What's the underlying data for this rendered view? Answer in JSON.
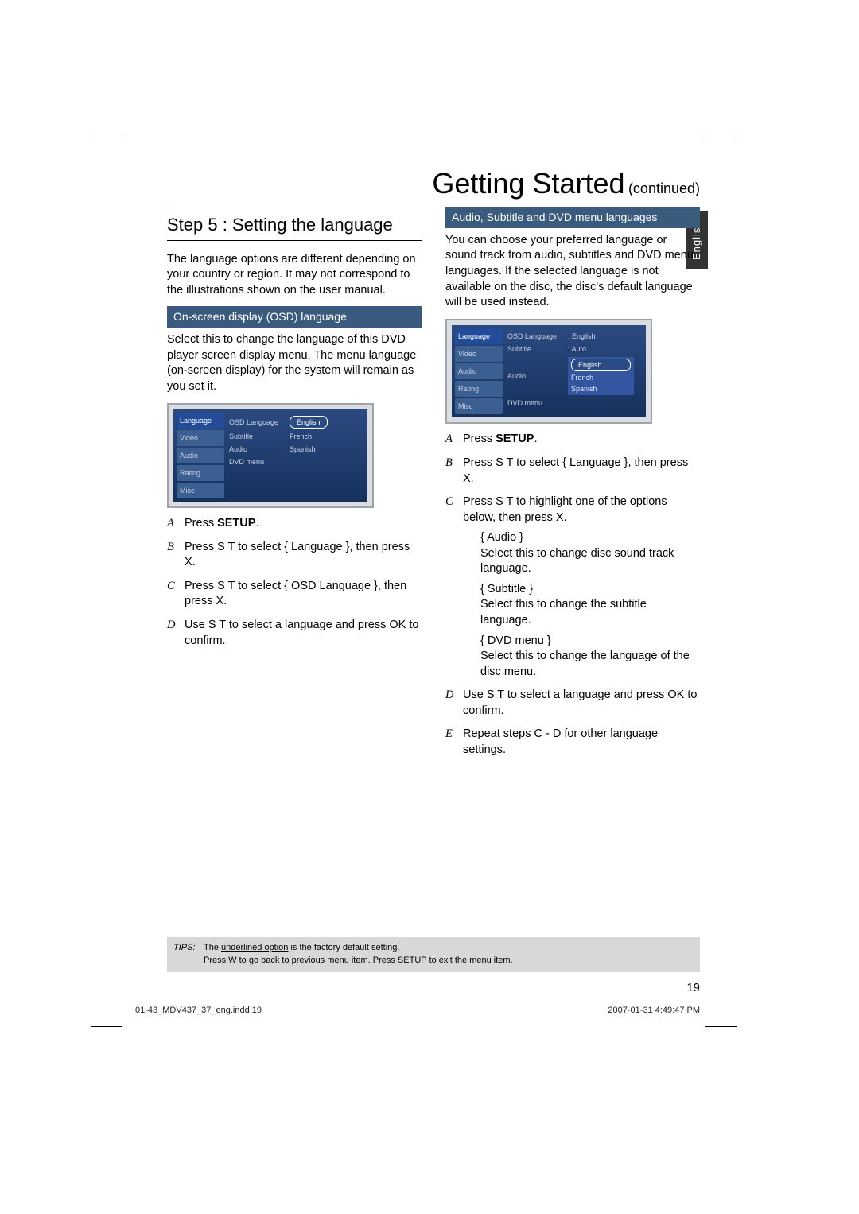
{
  "title": {
    "main": "Getting Started",
    "suffix": "(continued)"
  },
  "lang_tab": "English",
  "left": {
    "step_heading": "Step 5 : Setting the language",
    "intro": "The language options are different depending on your country or region. It may not correspond to the illustrations shown on the user manual.",
    "sub_heading": "On-screen display (OSD) language",
    "sub_body": "Select this to change the language of this DVD player screen display menu. The menu language (on-screen display) for the system will remain as you set it.",
    "menu": {
      "side": [
        "Language",
        "Video",
        "Audio",
        "Rating",
        "Misc"
      ],
      "rows": [
        {
          "lbl": "OSD Language",
          "val": "English",
          "pill": true
        },
        {
          "lbl": "Subtitle",
          "val": "French"
        },
        {
          "lbl": "Audio",
          "val": "Spanish"
        },
        {
          "lbl": "DVD menu",
          "val": ""
        }
      ]
    },
    "steps": [
      {
        "m": "A",
        "pre": "Press ",
        "kw": "SETUP",
        "post": "."
      },
      {
        "m": "B",
        "text": "Press  S  T to select { Language }, then press  X."
      },
      {
        "m": "C",
        "text": "Press  S  T to select { OSD Language }, then press  X."
      },
      {
        "m": "D",
        "text": "Use  S  T to select a language and press OK to confirm."
      }
    ]
  },
  "right": {
    "sub_heading": "Audio, Subtitle and DVD menu languages",
    "intro": "You can choose your preferred language or sound track from audio, subtitles and DVD menu languages. If the selected language is not available on the disc, the disc's default language will be used instead.",
    "menu": {
      "side": [
        "Language",
        "Video",
        "Audio",
        "Rating",
        "Misc"
      ],
      "rows": [
        {
          "lbl": "OSD Language",
          "val": ": English"
        },
        {
          "lbl": "Subtitle",
          "val": ": Auto"
        },
        {
          "lbl": "Audio",
          "box": [
            "English",
            "French",
            "Spanish"
          ],
          "pill_idx": 0
        },
        {
          "lbl": "DVD menu",
          "val": ""
        }
      ]
    },
    "steps": [
      {
        "m": "A",
        "pre": "Press ",
        "kw": "SETUP",
        "post": "."
      },
      {
        "m": "B",
        "text": "Press  S  T to select { Language }, then press  X."
      },
      {
        "m": "C",
        "text": "Press  S  T to highlight one of the options below, then press  X."
      },
      {
        "m": "D",
        "text": "Use  S  T to select a language and press OK to confirm."
      },
      {
        "m": "E",
        "text": "Repeat steps C - D for other language settings."
      }
    ],
    "options": [
      {
        "label": "{ Audio }",
        "desc": "Select this to change disc sound track language."
      },
      {
        "label": "{ Subtitle  }",
        "desc": "Select this to change the subtitle language."
      },
      {
        "label": "{ DVD menu  }",
        "desc": "Select this to change the language of the disc menu."
      }
    ]
  },
  "tips": {
    "label": "TIPS:",
    "line1a": "The ",
    "line1u": "underlined option",
    "line1b": " is the factory default setting.",
    "line2": "Press  W to go back to previous menu item. Press SETUP to exit the menu item."
  },
  "page_number": "19",
  "footer_left": "01-43_MDV437_37_eng.indd   19",
  "footer_right": "2007-01-31   4:49:47 PM"
}
